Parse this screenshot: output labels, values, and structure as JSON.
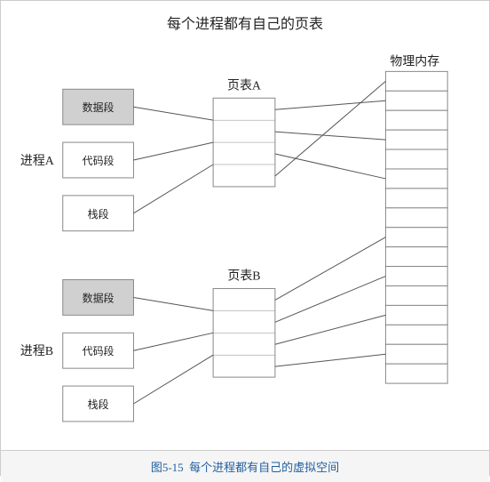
{
  "title": "每个进程都有自己的页表",
  "caption_label": "图5-15",
  "caption_text": "每个进程都有自己的虚拟空间",
  "process_a_label": "进程A",
  "process_b_label": "进程B",
  "memory_label": "物理内存",
  "page_table_a": "页表A",
  "page_table_b": "页表B",
  "segment_data": "数据段",
  "segment_code": "代码段",
  "segment_stack": "栈段"
}
